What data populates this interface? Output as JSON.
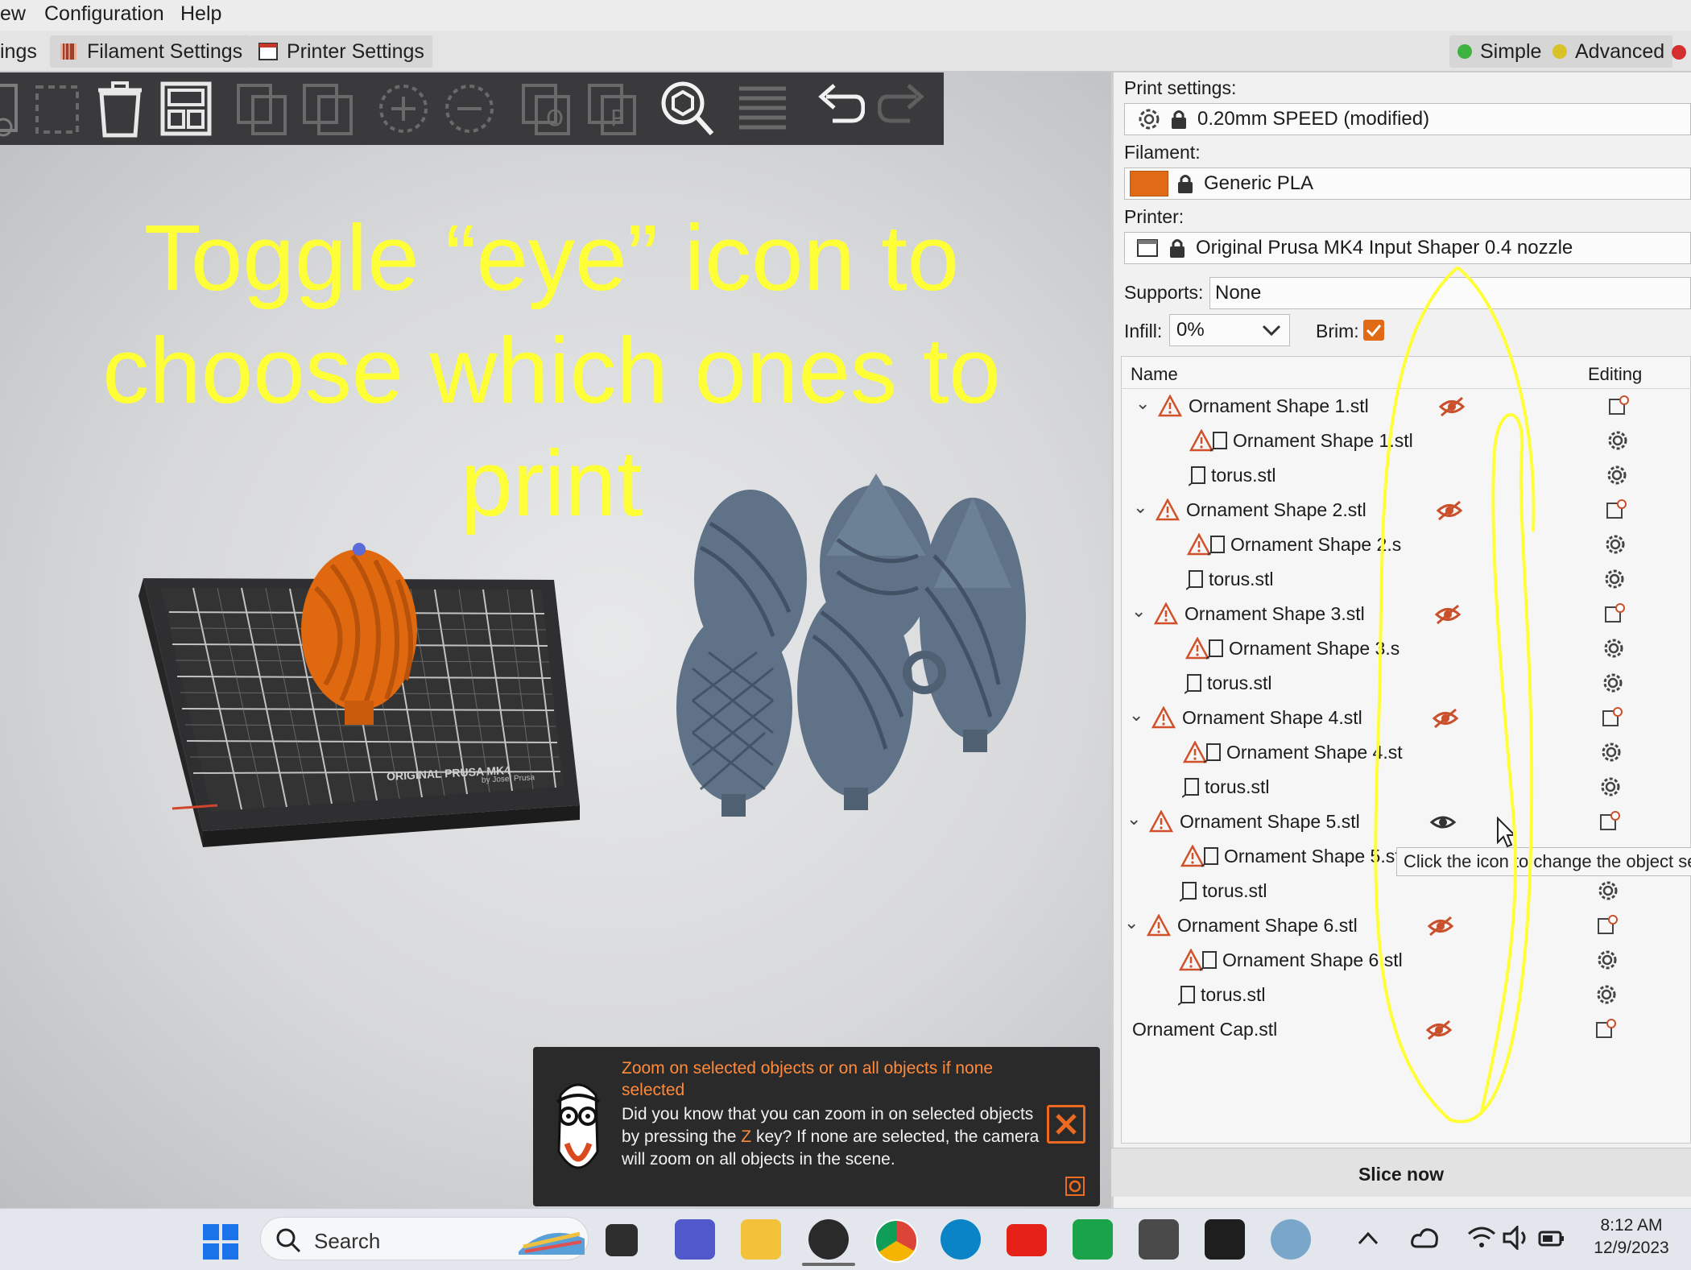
{
  "menu": {
    "items": [
      "ew",
      "Configuration",
      "Help"
    ]
  },
  "tabs": {
    "items": [
      "ings",
      "Filament Settings",
      "Printer Settings"
    ],
    "mode_simple": "Simple",
    "mode_advanced": "Advanced"
  },
  "overlay": {
    "line1": "Toggle “eye” icon to",
    "line2": "choose which ones to",
    "line3": "print"
  },
  "bed": {
    "brand_line": "ORIGINAL PRUSA MK4",
    "maker": "by Josef Prusa"
  },
  "panel": {
    "print_settings_label": "Print settings:",
    "print_settings_value": "0.20mm SPEED (modified)",
    "filament_label": "Filament:",
    "filament_value": "Generic PLA",
    "printer_label": "Printer:",
    "printer_value": "Original Prusa MK4 Input Shaper 0.4 nozzle",
    "supports_label": "Supports:",
    "supports_value": "None",
    "infill_label": "Infill:",
    "infill_value": "0%",
    "brim_label": "Brim:",
    "brim_checked": true,
    "col_name": "Name",
    "col_editing": "Editing",
    "slice_button": "Slice now",
    "tooltip": "Click the icon to change the object se"
  },
  "objects": [
    {
      "label": "Ornament Shape 1.stl",
      "visible": false
    },
    {
      "label": "Ornament Shape 1.stl"
    },
    {
      "label": "torus.stl"
    },
    {
      "label": "Ornament Shape 2.stl",
      "visible": false
    },
    {
      "label": "Ornament Shape 2.s"
    },
    {
      "label": "torus.stl"
    },
    {
      "label": "Ornament Shape 3.stl",
      "visible": false
    },
    {
      "label": "Ornament Shape 3.s"
    },
    {
      "label": "torus.stl"
    },
    {
      "label": "Ornament Shape 4.stl",
      "visible": false
    },
    {
      "label": "Ornament Shape 4.st"
    },
    {
      "label": "torus.stl"
    },
    {
      "label": "Ornament Shape 5.stl",
      "visible": true
    },
    {
      "label": "Ornament Shape 5.stl"
    },
    {
      "label": "torus.stl"
    },
    {
      "label": "Ornament Shape 6.stl",
      "visible": false
    },
    {
      "label": "Ornament Shape 6.stl"
    },
    {
      "label": "torus.stl"
    },
    {
      "label": "Ornament Cap.stl",
      "visible": false
    }
  ],
  "hint": {
    "title": "Zoom on selected objects or on all objects if none selected",
    "body_before": "Did you know that you can zoom in on selected objects by pressing the",
    "body_key": "Z",
    "body_after": "key? If none are selected, the camera will zoom on all objects in the scene."
  },
  "taskbar": {
    "search_label": "Search",
    "time": "8:12 AM",
    "date": "12/9/2023"
  },
  "colors": {
    "accent": "#ed6b21",
    "annotation": "#ffff38",
    "filament": "#e06a16"
  }
}
